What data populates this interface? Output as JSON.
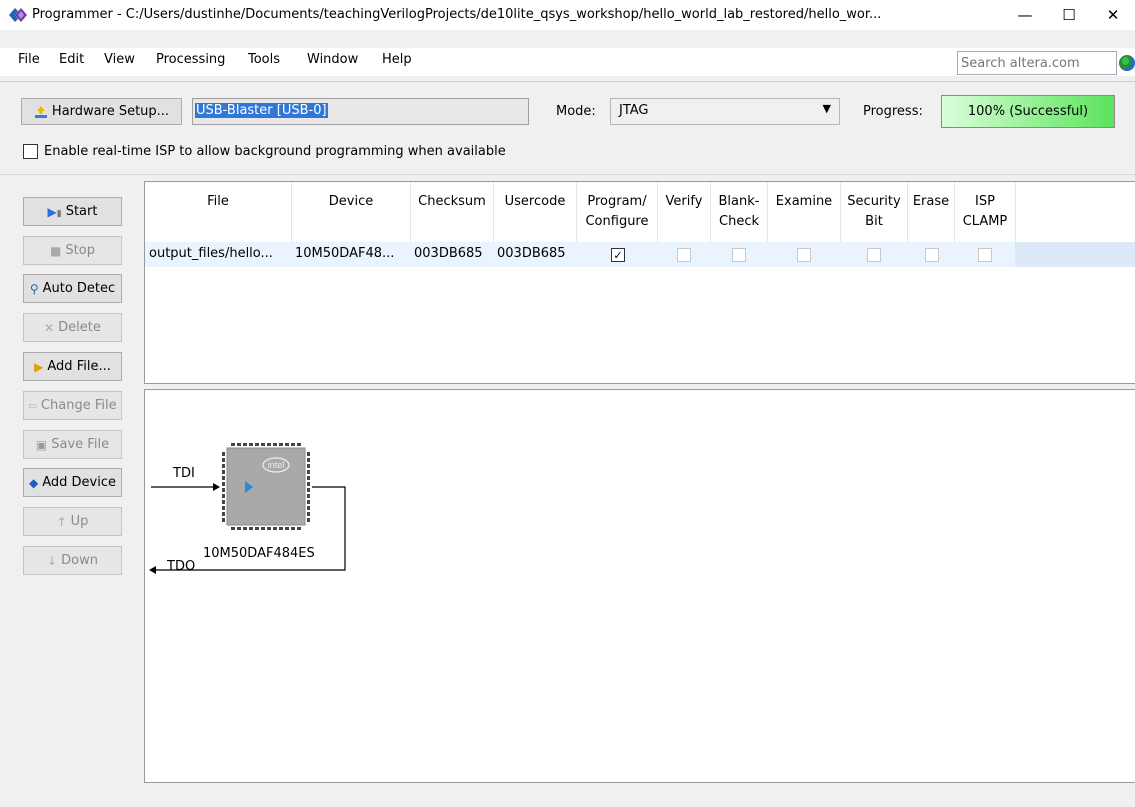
{
  "window": {
    "title": "Programmer - C:/Users/dustinhe/Documents/teachingVerilogProjects/de10lite_qsys_workshop/hello_world_lab_restored/hello_wor...",
    "minimize_glyph": "—",
    "maximize_glyph": "☐",
    "close_glyph": "✕"
  },
  "menu": {
    "items": [
      "File",
      "Edit",
      "View",
      "Processing",
      "Tools",
      "Window",
      "Help"
    ],
    "search_placeholder": "Search altera.com"
  },
  "hardware": {
    "setup_label": "Hardware Setup...",
    "device": "USB-Blaster [USB-0]",
    "mode_label": "Mode:",
    "mode_value": "JTAG",
    "progress_label": "Progress:",
    "progress_text": "100% (Successful)",
    "progress_percent": 100,
    "isp_label": "Enable real-time ISP to allow background programming when available",
    "isp_checked": false
  },
  "sidebar": {
    "buttons": [
      {
        "label": "Start",
        "icon": "start-icon",
        "enabled": true
      },
      {
        "label": "Stop",
        "icon": "stop-icon",
        "enabled": false
      },
      {
        "label": "Auto Detec",
        "icon": "auto-detect-icon",
        "enabled": true
      },
      {
        "label": "Delete",
        "icon": "delete-icon",
        "enabled": false
      },
      {
        "label": "Add File...",
        "icon": "add-file-icon",
        "enabled": true
      },
      {
        "label": "Change File",
        "icon": "change-file-icon",
        "enabled": false
      },
      {
        "label": "Save File",
        "icon": "save-file-icon",
        "enabled": false
      },
      {
        "label": "Add Device",
        "icon": "add-device-icon",
        "enabled": true
      },
      {
        "label": "Up",
        "icon": "up-icon",
        "enabled": false
      },
      {
        "label": "Down",
        "icon": "down-icon",
        "enabled": false
      }
    ]
  },
  "table": {
    "headers": [
      [
        "File"
      ],
      [
        "Device"
      ],
      [
        "Checksum"
      ],
      [
        "Usercode"
      ],
      [
        "Program/",
        "Configure"
      ],
      [
        "Verify"
      ],
      [
        "Blank-",
        "Check"
      ],
      [
        "Examine"
      ],
      [
        "Security",
        "Bit"
      ],
      [
        "Erase"
      ],
      [
        "ISP",
        "CLAMP"
      ]
    ],
    "rows": [
      {
        "file": "output_files/hello...",
        "device": "10M50DAF48...",
        "checksum": "003DB685",
        "usercode": "003DB685",
        "program_configure": true,
        "verify": false,
        "blank_check": false,
        "examine": false,
        "security_bit": false,
        "erase": false,
        "isp_clamp": false
      }
    ]
  },
  "chain": {
    "tdi_label": "TDI",
    "tdo_label": "TDO",
    "device_label": "10M50DAF484ES",
    "chip_logo": "intel"
  },
  "colors": {
    "progress_fill": "#5be35b",
    "selection": "#3178d6",
    "row_highlight": "#eaf4ff"
  }
}
